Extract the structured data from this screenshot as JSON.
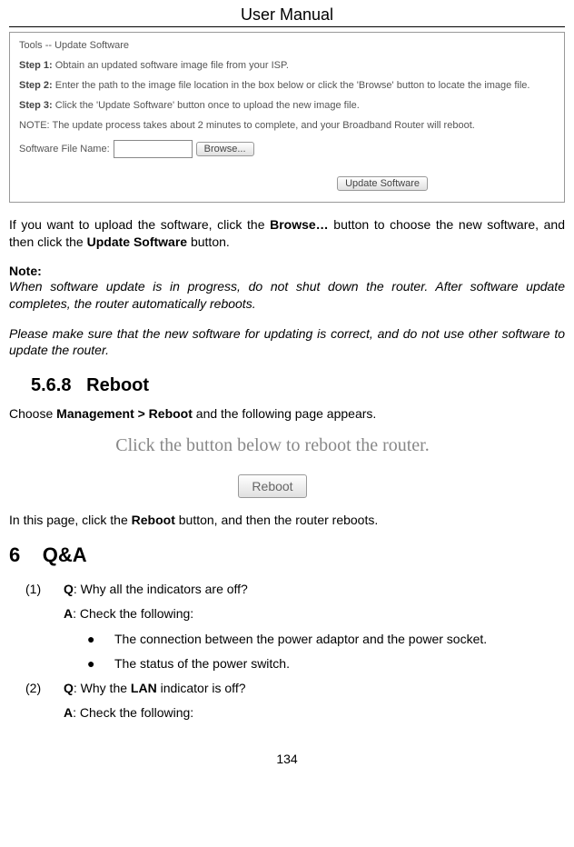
{
  "header": "User Manual",
  "screenshot1": {
    "title": "Tools -- Update Software",
    "step1_label": "Step 1:",
    "step1_text": " Obtain an updated software image file from your ISP.",
    "step2_label": "Step 2:",
    "step2_text": " Enter the path to the image file location in the box below or click the 'Browse' button to locate the image file.",
    "step3_label": "Step 3:",
    "step3_text": " Click the 'Update Software' button once to upload the new image file.",
    "note": "NOTE: The update process takes about 2 minutes to complete, and your Broadband Router will reboot.",
    "file_label": "Software File Name:",
    "browse_btn": "Browse...",
    "update_btn": "Update Software"
  },
  "para1_a": "If you want to upload the software, click the ",
  "para1_b": "Browse…",
  "para1_c": " button to choose the new software, and then click the ",
  "para1_d": "Update Software",
  "para1_e": " button.",
  "note_label": "Note:",
  "note_text1": "When software update is in progress, do not shut down the router. After software update completes, the router automatically reboots.",
  "note_text2": "Please make sure that the new software for updating is correct, and do not use other software to update the router.",
  "section_num": "5.6.8",
  "section_title": "Reboot",
  "para2_a": "Choose ",
  "para2_b": "Management > Reboot",
  "para2_c": " and the following page appears.",
  "reboot_screenshot_text": "Click the button below to reboot the router.",
  "reboot_btn": "Reboot",
  "para3_a": "In this page, click the ",
  "para3_b": "Reboot",
  "para3_c": " button, and then the router reboots.",
  "chapter_num": "6",
  "chapter_title": "Q&A",
  "qa": {
    "item1_num": "(1)",
    "q_label": "Q",
    "a_label": "A",
    "q1": ": Why all the indicators are off?",
    "a1": ": Check the following:",
    "bullet1": "The connection between the power adaptor and the power socket.",
    "bullet2": "The status of the power switch.",
    "item2_num": "(2)",
    "q2_a": ": Why the ",
    "q2_b": "LAN",
    "q2_c": " indicator is off?",
    "a2": ": Check the following:"
  },
  "page_number": "134"
}
